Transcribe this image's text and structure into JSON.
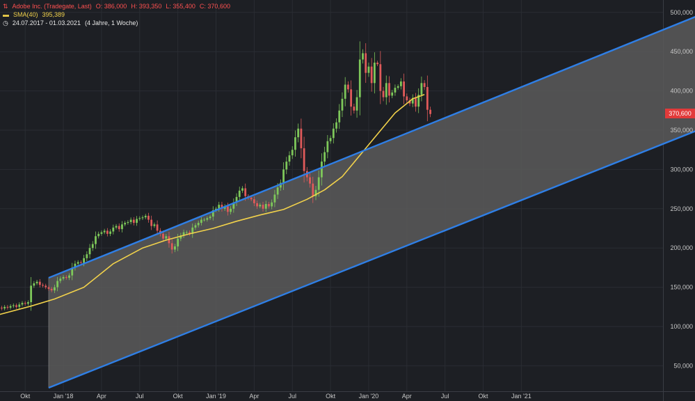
{
  "legend": {
    "instrument": "Adobe Inc. (Tradegate, Last)",
    "open": "O: 386,000",
    "high": "H: 393,350",
    "low": "L: 355,400",
    "close": "C: 370,600",
    "sma_label": "SMA(40)",
    "sma_value": "395,389",
    "period": "24.07.2017 - 01.03.2021",
    "period_note": "(4 Jahre, 1 Woche)"
  },
  "last_price_tag": "370,600",
  "colors": {
    "background": "#1d1f24",
    "grid": "#2a2d33",
    "channel_line": "#2f7fe6",
    "channel_fill": "#5a5a5a",
    "sma": "#f2d24b",
    "up_candle": "#7ec85a",
    "down_candle": "#e05a5a",
    "price_tag": "#e23a3a"
  },
  "chart_data": {
    "type": "candlestick",
    "y_axis": {
      "position": "right",
      "range": [
        0,
        510000
      ],
      "ticks": [
        50000,
        100000,
        150000,
        200000,
        250000,
        300000,
        350000,
        400000,
        450000,
        500000
      ],
      "tick_labels": [
        "50,000",
        "100,000",
        "150,000",
        "200,000",
        "250,000",
        "300,000",
        "350,000",
        "400,000",
        "450,000",
        "500,000"
      ]
    },
    "x_axis": {
      "labels": [
        "Okt",
        "Jan '18",
        "Apr",
        "Jul",
        "Okt",
        "Jan '19",
        "Apr",
        "Jul",
        "Okt",
        "Jan '20",
        "Apr",
        "Jul",
        "Okt",
        "Jan '21"
      ],
      "label_weeks": [
        10,
        23,
        36,
        49,
        62,
        75,
        88,
        101,
        114,
        127,
        140,
        153,
        166,
        179
      ]
    },
    "grid": true,
    "weekly_closes": [
      122000,
      124000,
      123000,
      125000,
      124000,
      126000,
      127000,
      125000,
      128000,
      130000,
      129000,
      131000,
      152000,
      155000,
      157000,
      153000,
      152000,
      150000,
      148000,
      146000,
      150000,
      158000,
      161000,
      163000,
      162000,
      165000,
      175000,
      180000,
      182000,
      181000,
      187000,
      192000,
      200000,
      205000,
      215000,
      218000,
      220000,
      222000,
      218000,
      221000,
      226000,
      228000,
      224000,
      230000,
      232000,
      233000,
      236000,
      232000,
      237000,
      238000,
      239000,
      241000,
      236000,
      228000,
      230000,
      222000,
      218000,
      212000,
      215000,
      206000,
      198000,
      202000,
      212000,
      216000,
      220000,
      220000,
      218000,
      226000,
      229000,
      232000,
      236000,
      236000,
      238000,
      240000,
      248000,
      250000,
      255000,
      250000,
      253000,
      246000,
      250000,
      258000,
      265000,
      273000,
      276000,
      266000,
      264000,
      262000,
      257000,
      253000,
      255000,
      250000,
      256000,
      253000,
      258000,
      268000,
      277000,
      283000,
      300000,
      310000,
      318000,
      325000,
      341000,
      352000,
      327000,
      298000,
      290000,
      282000,
      266000,
      274000,
      290000,
      310000,
      322000,
      336000,
      340000,
      352000,
      360000,
      375000,
      390000,
      408000,
      402000,
      380000,
      375000,
      392000,
      440000,
      448000,
      423000,
      431000,
      410000,
      436000,
      434000,
      400000,
      392000,
      410000,
      394000,
      398000,
      404000,
      406000,
      412000,
      393000,
      388000,
      384000,
      391000,
      380000,
      395000,
      410000,
      405000,
      376000,
      370600
    ],
    "weekly_closes_note_removed": true,
    "sma40": {
      "name": "SMA(40)",
      "values": [
        [
          0,
          114000
        ],
        [
          12,
          126000
        ],
        [
          20,
          135000
        ],
        [
          30,
          150000
        ],
        [
          40,
          180000
        ],
        [
          50,
          200000
        ],
        [
          58,
          210000
        ],
        [
          66,
          218000
        ],
        [
          74,
          225000
        ],
        [
          82,
          234000
        ],
        [
          90,
          242000
        ],
        [
          98,
          249000
        ],
        [
          106,
          262000
        ],
        [
          112,
          274000
        ],
        [
          118,
          291000
        ],
        [
          124,
          318000
        ],
        [
          130,
          345000
        ],
        [
          136,
          372000
        ],
        [
          142,
          390000
        ],
        [
          146,
          395389
        ]
      ]
    },
    "channel": {
      "upper_start": [
        18,
        162000
      ],
      "upper_end": [
        242,
        500000
      ],
      "lower_start": [
        18,
        22000
      ],
      "lower_end": [
        262,
        384000
      ]
    },
    "last_price": 370600
  }
}
